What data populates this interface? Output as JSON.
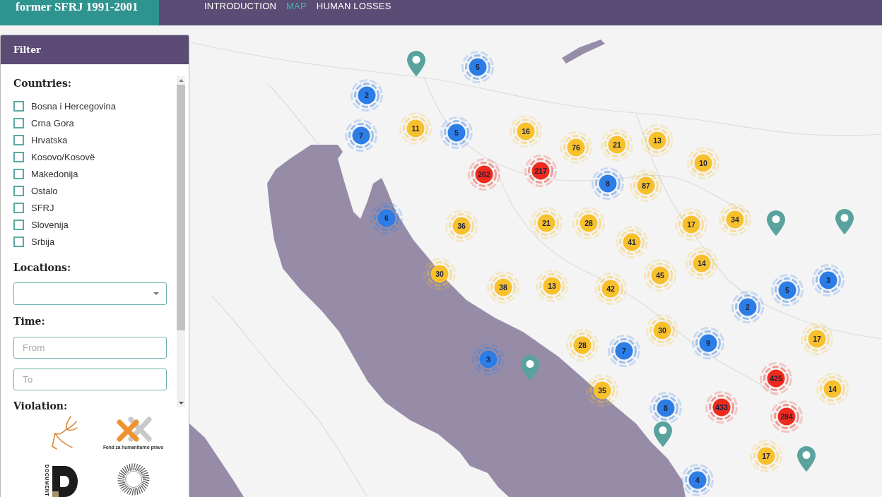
{
  "header": {
    "title": "former SFRJ 1991-2001",
    "nav": [
      {
        "label": "INTRODUCTION",
        "selected": false
      },
      {
        "label": "MAP",
        "selected": true
      },
      {
        "label": "HUMAN LOSSES",
        "selected": false
      }
    ]
  },
  "filter": {
    "title": "Filter",
    "countries_label": "Countries:",
    "countries": [
      {
        "label": "Bosna i Hercegovina",
        "checked": false
      },
      {
        "label": "Crna Gora",
        "checked": false
      },
      {
        "label": "Hrvatska",
        "checked": false
      },
      {
        "label": "Kosovo/Kosovë",
        "checked": false
      },
      {
        "label": "Makedonija",
        "checked": false
      },
      {
        "label": "Ostalo",
        "checked": false
      },
      {
        "label": "SFRJ",
        "checked": false
      },
      {
        "label": "Slovenija",
        "checked": false
      },
      {
        "label": "Srbija",
        "checked": false
      }
    ],
    "locations_label": "Locations:",
    "time_label": "Time:",
    "from": {
      "placeholder": "From"
    },
    "to": {
      "placeholder": "To"
    },
    "violation_label": "Violation:"
  },
  "logos": [
    {
      "kind": "line-art"
    },
    {
      "kind": "cross",
      "caption": "Fond za humanitarno pravo"
    },
    {
      "kind": "letter",
      "caption": "DOCUMENT"
    },
    {
      "kind": "sunburst"
    }
  ],
  "markers": [
    {
      "kind": "pin"
    },
    {
      "kind": "cluster",
      "count": "5",
      "color": "#2c7de6"
    },
    {
      "kind": "cluster",
      "count": "2",
      "color": "#2c7de6"
    },
    {
      "kind": "cluster",
      "count": "7",
      "color": "#2c7de6"
    },
    {
      "kind": "cluster",
      "count": "11",
      "color": "#f8c12c"
    },
    {
      "kind": "cluster",
      "count": "5",
      "color": "#2c7de6"
    },
    {
      "kind": "cluster",
      "count": "16",
      "color": "#f8c12c"
    },
    {
      "kind": "cluster",
      "count": "76",
      "color": "#f8c12c"
    },
    {
      "kind": "cluster",
      "count": "21",
      "color": "#f8c12c"
    },
    {
      "kind": "cluster",
      "count": "13",
      "color": "#f8c12c"
    },
    {
      "kind": "cluster",
      "count": "262",
      "color": "#ee2a1c"
    },
    {
      "kind": "cluster",
      "count": "217",
      "color": "#ee2a1c"
    },
    {
      "kind": "cluster",
      "count": "8",
      "color": "#2c7de6"
    },
    {
      "kind": "cluster",
      "count": "87",
      "color": "#f8c12c"
    },
    {
      "kind": "cluster",
      "count": "10",
      "color": "#f8c12c"
    },
    {
      "kind": "cluster",
      "count": "6",
      "color": "#2c7de6"
    },
    {
      "kind": "cluster",
      "count": "36",
      "color": "#f8c12c"
    },
    {
      "kind": "cluster",
      "count": "21",
      "color": "#f8c12c"
    },
    {
      "kind": "cluster",
      "count": "28",
      "color": "#f8c12c"
    },
    {
      "kind": "cluster",
      "count": "17",
      "color": "#f8c12c"
    },
    {
      "kind": "cluster",
      "count": "34",
      "color": "#f8c12c"
    },
    {
      "kind": "pin"
    },
    {
      "kind": "pin"
    },
    {
      "kind": "cluster",
      "count": "41",
      "color": "#f8c12c"
    },
    {
      "kind": "cluster",
      "count": "30",
      "color": "#f8c12c"
    },
    {
      "kind": "cluster",
      "count": "38",
      "color": "#f8c12c"
    },
    {
      "kind": "cluster",
      "count": "13",
      "color": "#f8c12c"
    },
    {
      "kind": "cluster",
      "count": "42",
      "color": "#f8c12c"
    },
    {
      "kind": "cluster",
      "count": "45",
      "color": "#f8c12c"
    },
    {
      "kind": "cluster",
      "count": "14",
      "color": "#f8c12c"
    },
    {
      "kind": "cluster",
      "count": "2",
      "color": "#2c7de6"
    },
    {
      "kind": "cluster",
      "count": "5",
      "color": "#2c7de6"
    },
    {
      "kind": "cluster",
      "count": "3",
      "color": "#2c7de6"
    },
    {
      "kind": "cluster",
      "count": "3",
      "color": "#2c7de6"
    },
    {
      "kind": "pin"
    },
    {
      "kind": "cluster",
      "count": "28",
      "color": "#f8c12c"
    },
    {
      "kind": "cluster",
      "count": "7",
      "color": "#2c7de6"
    },
    {
      "kind": "cluster",
      "count": "30",
      "color": "#f8c12c"
    },
    {
      "kind": "cluster",
      "count": "9",
      "color": "#2c7de6"
    },
    {
      "kind": "cluster",
      "count": "17",
      "color": "#f8c12c"
    },
    {
      "kind": "cluster",
      "count": "35",
      "color": "#f8c12c"
    },
    {
      "kind": "cluster",
      "count": "8",
      "color": "#2c7de6"
    },
    {
      "kind": "cluster",
      "count": "433",
      "color": "#ee2a1c"
    },
    {
      "kind": "cluster",
      "count": "425",
      "color": "#ee2a1c"
    },
    {
      "kind": "cluster",
      "count": "284",
      "color": "#ee2a1c"
    },
    {
      "kind": "cluster",
      "count": "14",
      "color": "#f8c12c"
    },
    {
      "kind": "pin"
    },
    {
      "kind": "cluster",
      "count": "4",
      "color": "#2c7de6"
    },
    {
      "kind": "cluster",
      "count": "17",
      "color": "#f8c12c"
    },
    {
      "kind": "pin"
    }
  ]
}
